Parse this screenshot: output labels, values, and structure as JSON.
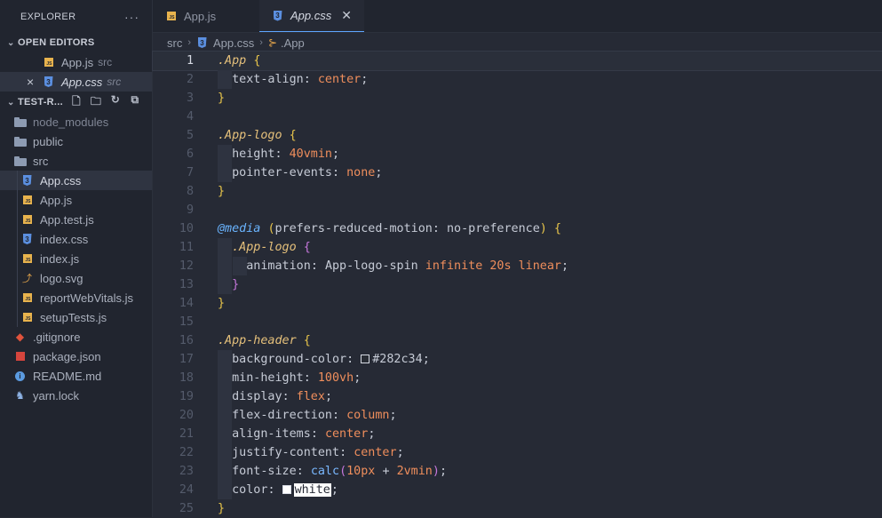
{
  "explorer": {
    "title": "EXPLORER",
    "more": "···",
    "open_editors_title": "OPEN EDITORS",
    "open_editors": [
      {
        "name": "App.js",
        "desc": "src",
        "type": "js",
        "active": false
      },
      {
        "name": "App.css",
        "desc": "src",
        "type": "css",
        "active": true,
        "close": "×"
      }
    ],
    "project_title": "TEST-R...",
    "tree": [
      {
        "name": "node_modules",
        "type": "node-folder"
      },
      {
        "name": "public",
        "type": "folder"
      },
      {
        "name": "src",
        "type": "folder-open"
      },
      {
        "name": "App.css",
        "type": "css",
        "selected": true
      },
      {
        "name": "App.js",
        "type": "js"
      },
      {
        "name": "App.test.js",
        "type": "js"
      },
      {
        "name": "index.css",
        "type": "css"
      },
      {
        "name": "index.js",
        "type": "js"
      },
      {
        "name": "logo.svg",
        "type": "svg"
      },
      {
        "name": "reportWebVitals.js",
        "type": "js"
      },
      {
        "name": "setupTests.js",
        "type": "js"
      },
      {
        "name": ".gitignore",
        "type": "git"
      },
      {
        "name": "package.json",
        "type": "npm"
      },
      {
        "name": "README.md",
        "type": "info"
      },
      {
        "name": "yarn.lock",
        "type": "yarn"
      }
    ]
  },
  "tabs": [
    {
      "label": "App.js",
      "type": "js",
      "active": false
    },
    {
      "label": "App.css",
      "type": "css",
      "active": true,
      "close": "✕"
    }
  ],
  "breadcrumb": {
    "folder": "src",
    "file": "App.css",
    "symbol": ".App"
  },
  "code": {
    "current_line": 1,
    "lines": [
      ".App {",
      "  text-align: center;",
      "}",
      "",
      ".App-logo {",
      "  height: 40vmin;",
      "  pointer-events: none;",
      "}",
      "",
      "@media (prefers-reduced-motion: no-preference) {",
      "  .App-logo {",
      "    animation: App-logo-spin infinite 20s linear;",
      "  }",
      "}",
      "",
      ".App-header {",
      "  background-color: #282c34;",
      "  min-height: 100vh;",
      "  display: flex;",
      "  flex-direction: column;",
      "  align-items: center;",
      "  justify-content: center;",
      "  font-size: calc(10px + 2vmin);",
      "  color: white;",
      "}"
    ]
  },
  "colors": {
    "swatch_282c34": "#282c34",
    "swatch_white": "#ffffff"
  }
}
